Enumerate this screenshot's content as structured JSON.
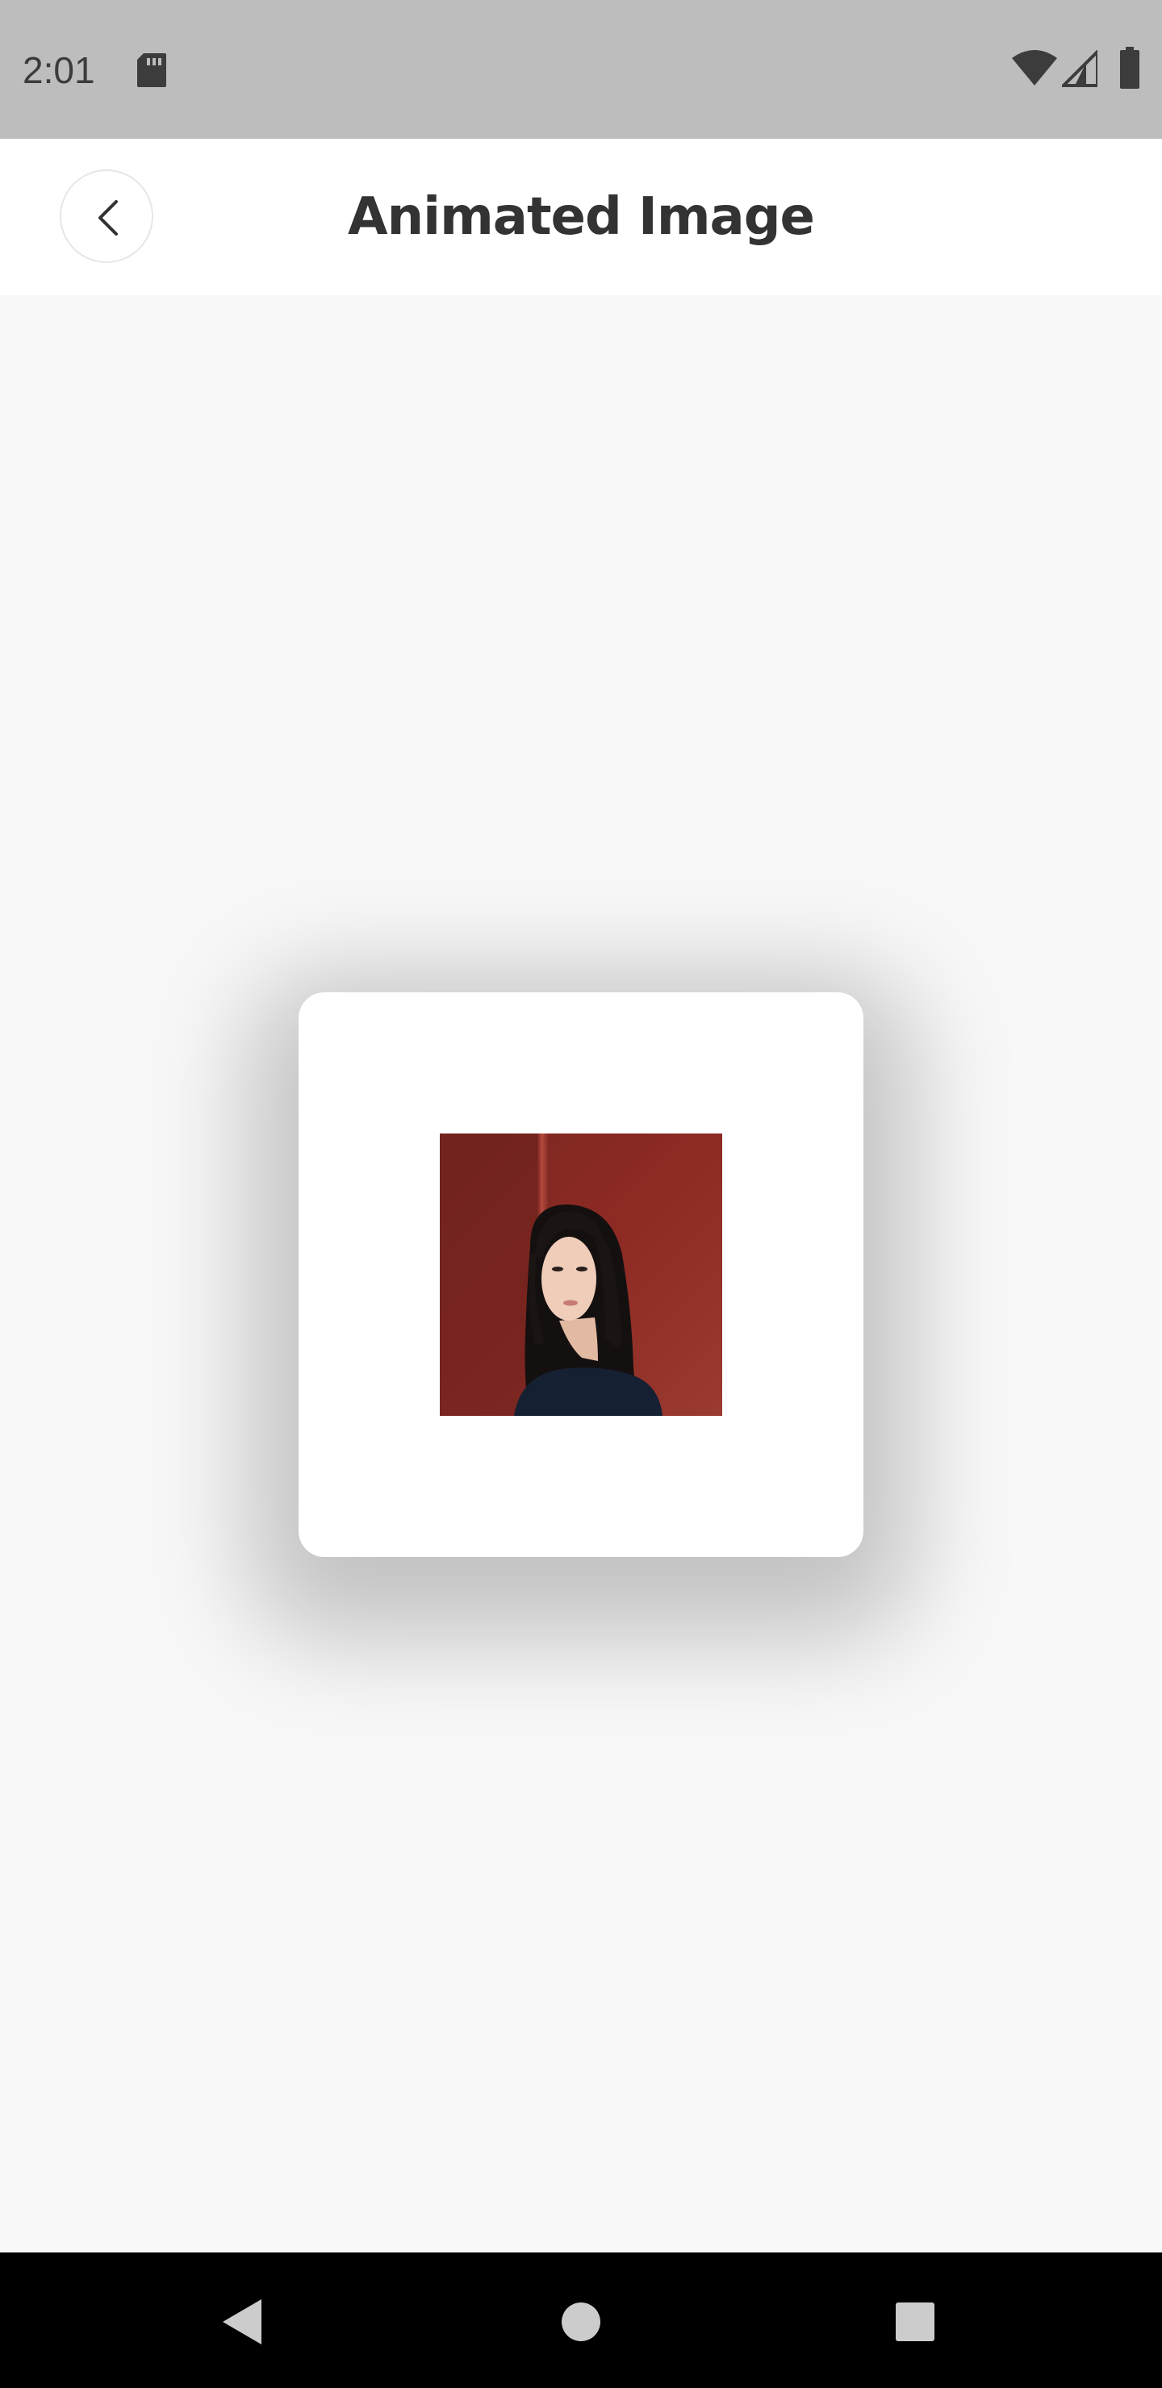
{
  "status_bar": {
    "time": "2:01",
    "icons": [
      "sd-card-icon",
      "wifi-icon",
      "cell-signal-icon",
      "battery-icon"
    ],
    "background": "#bdbdbd"
  },
  "app_bar": {
    "title": "Animated Image",
    "back_icon": "chevron-left-icon"
  },
  "content": {
    "card": {
      "image": "portrait-photo"
    }
  },
  "nav_bar": {
    "icons": [
      "back-triangle-icon",
      "home-circle-icon",
      "recents-square-icon"
    ]
  },
  "colors": {
    "page_background": "#f8f8f8",
    "title_text": "#333333",
    "photo_background": "#8e2a24"
  }
}
